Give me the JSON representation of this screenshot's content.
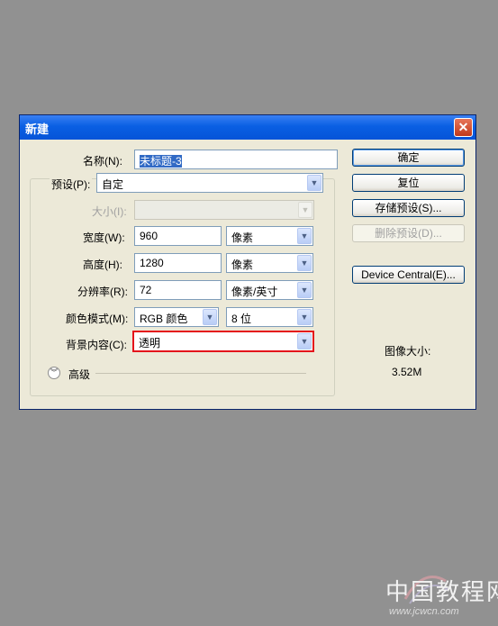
{
  "dialog": {
    "title": "新建",
    "close_glyph": "✕"
  },
  "form": {
    "name_label": "名称(N):",
    "name_value": "未标题-3",
    "preset_label": "预设(P):",
    "preset_value": "自定",
    "size_label": "大小(I):",
    "width_label": "宽度(W):",
    "width_value": "960",
    "width_unit": "像素",
    "height_label": "高度(H):",
    "height_value": "1280",
    "height_unit": "像素",
    "resolution_label": "分辨率(R):",
    "resolution_value": "72",
    "resolution_unit": "像素/英寸",
    "color_mode_label": "颜色模式(M):",
    "color_mode_value": "RGB 颜色",
    "bit_depth_value": "8 位",
    "bg_label": "背景内容(C):",
    "bg_value": "透明",
    "advanced_label": "高级"
  },
  "buttons": {
    "ok": "确定",
    "reset": "复位",
    "save_preset": "存储预设(S)...",
    "delete_preset": "删除预设(D)...",
    "device_central": "Device Central(E)..."
  },
  "info": {
    "image_size_label": "图像大小:",
    "image_size_value": "3.52M"
  },
  "watermark": {
    "site_cn": "中国教程网",
    "site_url": "www.jcwcn.com"
  },
  "colors": {
    "background": "#919191",
    "dialog": "#ece9d8",
    "titlebar": "#0a5fe3",
    "highlight_border": "#e4141b"
  },
  "icons": {
    "dropdown": "chevron-down-icon",
    "close": "close-icon",
    "expand": "double-chevron-down-icon"
  }
}
